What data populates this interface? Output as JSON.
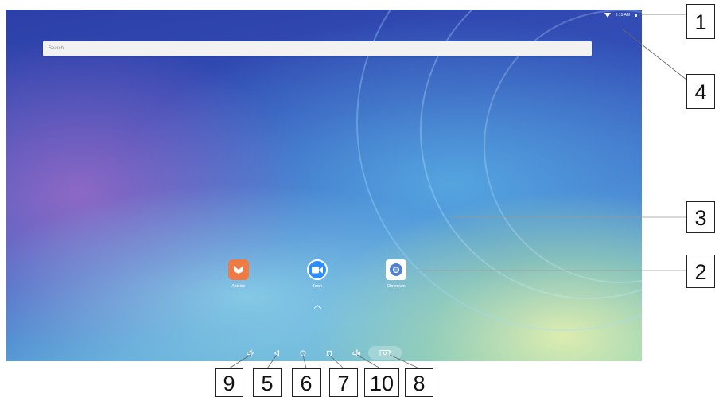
{
  "status_bar": {
    "time": "3:15 AM",
    "wifi_icon": "wifi-icon"
  },
  "search": {
    "placeholder": "Search"
  },
  "apps": [
    {
      "label": "Aptoide",
      "icon": "aptoide-icon",
      "color": "#f07a43"
    },
    {
      "label": "Zoom",
      "icon": "zoom-camera-icon",
      "color": "#2d8cff"
    },
    {
      "label": "Chromium",
      "icon": "chromium-icon",
      "color": "#4f7fd6"
    }
  ],
  "nav_bar": {
    "volume_down_icon": "volume-down-icon",
    "back_icon": "back-icon",
    "home_icon": "home-icon",
    "recents_icon": "recents-icon",
    "volume_up_icon": "volume-up-icon",
    "screenshot_icon": "screenshot-icon"
  },
  "callouts": {
    "c1": "1",
    "c2": "2",
    "c3": "3",
    "c4": "4",
    "c5": "5",
    "c6": "6",
    "c7": "7",
    "c8": "8",
    "c9": "9",
    "c10": "10"
  }
}
